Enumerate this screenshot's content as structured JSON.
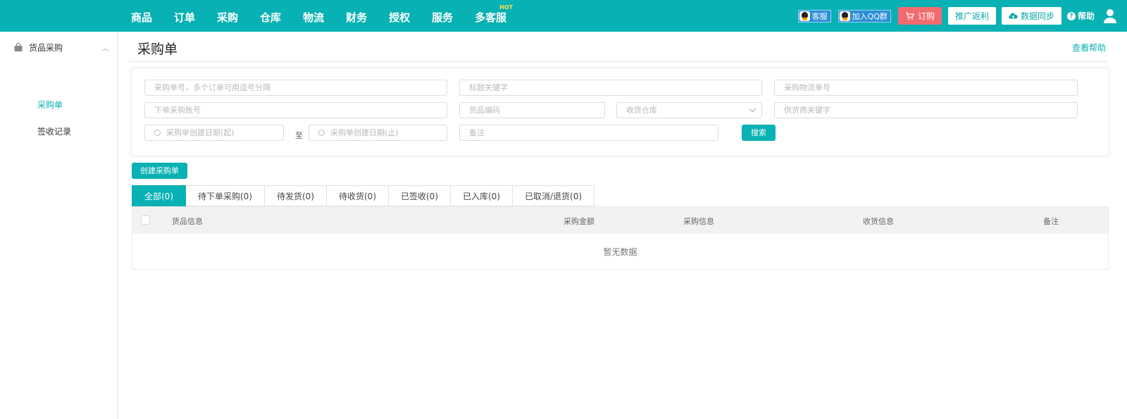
{
  "nav": {
    "items": [
      "商品",
      "订单",
      "采购",
      "仓库",
      "物流",
      "财务",
      "授权",
      "服务",
      "多客服"
    ],
    "hot_badge": "HOT"
  },
  "toolbar": {
    "customer_service": "客服",
    "join_qq_group": "加入QQ群",
    "order": "订购",
    "promo_rebate": "推广返利",
    "data_sync": "数据同步",
    "help": "帮助"
  },
  "sidebar": {
    "group_label": "货品采购",
    "items": [
      "采购单",
      "签收记录"
    ]
  },
  "page": {
    "title": "采购单",
    "help_link": "查看帮助"
  },
  "filters": {
    "order_no": "采购单号，多个订单可用逗号分隔",
    "title_keyword": "标题关键字",
    "logistics_no": "采购物流单号",
    "account": "下单采购账号",
    "goods_code": "货品编码",
    "warehouse": "收货仓库",
    "supplier_keyword": "供货商关键字",
    "date_start": "采购单创建日期(起)",
    "date_to": "至",
    "date_end": "采购单创建日期(止)",
    "remark": "备注",
    "search_button": "搜索"
  },
  "create_button": "创建采购单",
  "tabs": [
    "全部(0)",
    "待下单采购(0)",
    "待发货(0)",
    "待收货(0)",
    "已签收(0)",
    "已入库(0)",
    "已取消/退货(0)"
  ],
  "table": {
    "columns": [
      "货品信息",
      "采购金额",
      "采购信息",
      "收货信息",
      "备注"
    ],
    "empty_text": "暂无数据"
  },
  "colors": {
    "primary": "#08b1b3",
    "order_button": "#f26b6f"
  }
}
